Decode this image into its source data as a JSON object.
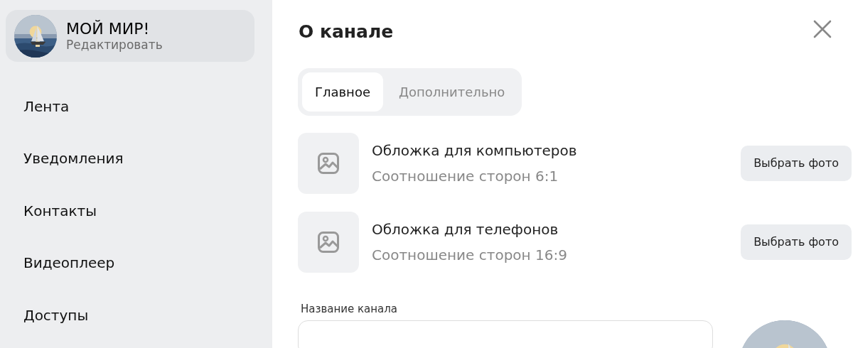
{
  "profile": {
    "name": "МОЙ МИР!",
    "action": "Редактировать"
  },
  "sidebar": {
    "items": [
      {
        "label": "Лента"
      },
      {
        "label": "Уведомления"
      },
      {
        "label": "Контакты"
      },
      {
        "label": "Видеоплеер"
      },
      {
        "label": "Доступы"
      }
    ]
  },
  "dialog": {
    "title": "О канале",
    "tabs": [
      {
        "label": "Главное",
        "selected": true
      },
      {
        "label": "Дополнительно",
        "selected": false
      }
    ],
    "covers": [
      {
        "title": "Обложка для компьютеров",
        "subtitle": "Соотношение сторон 6:1",
        "button": "Выбрать фото"
      },
      {
        "title": "Обложка для телефонов",
        "subtitle": "Соотношение сторон 16:9",
        "button": "Выбрать фото"
      }
    ],
    "name_field": {
      "label": "Название канала"
    }
  }
}
